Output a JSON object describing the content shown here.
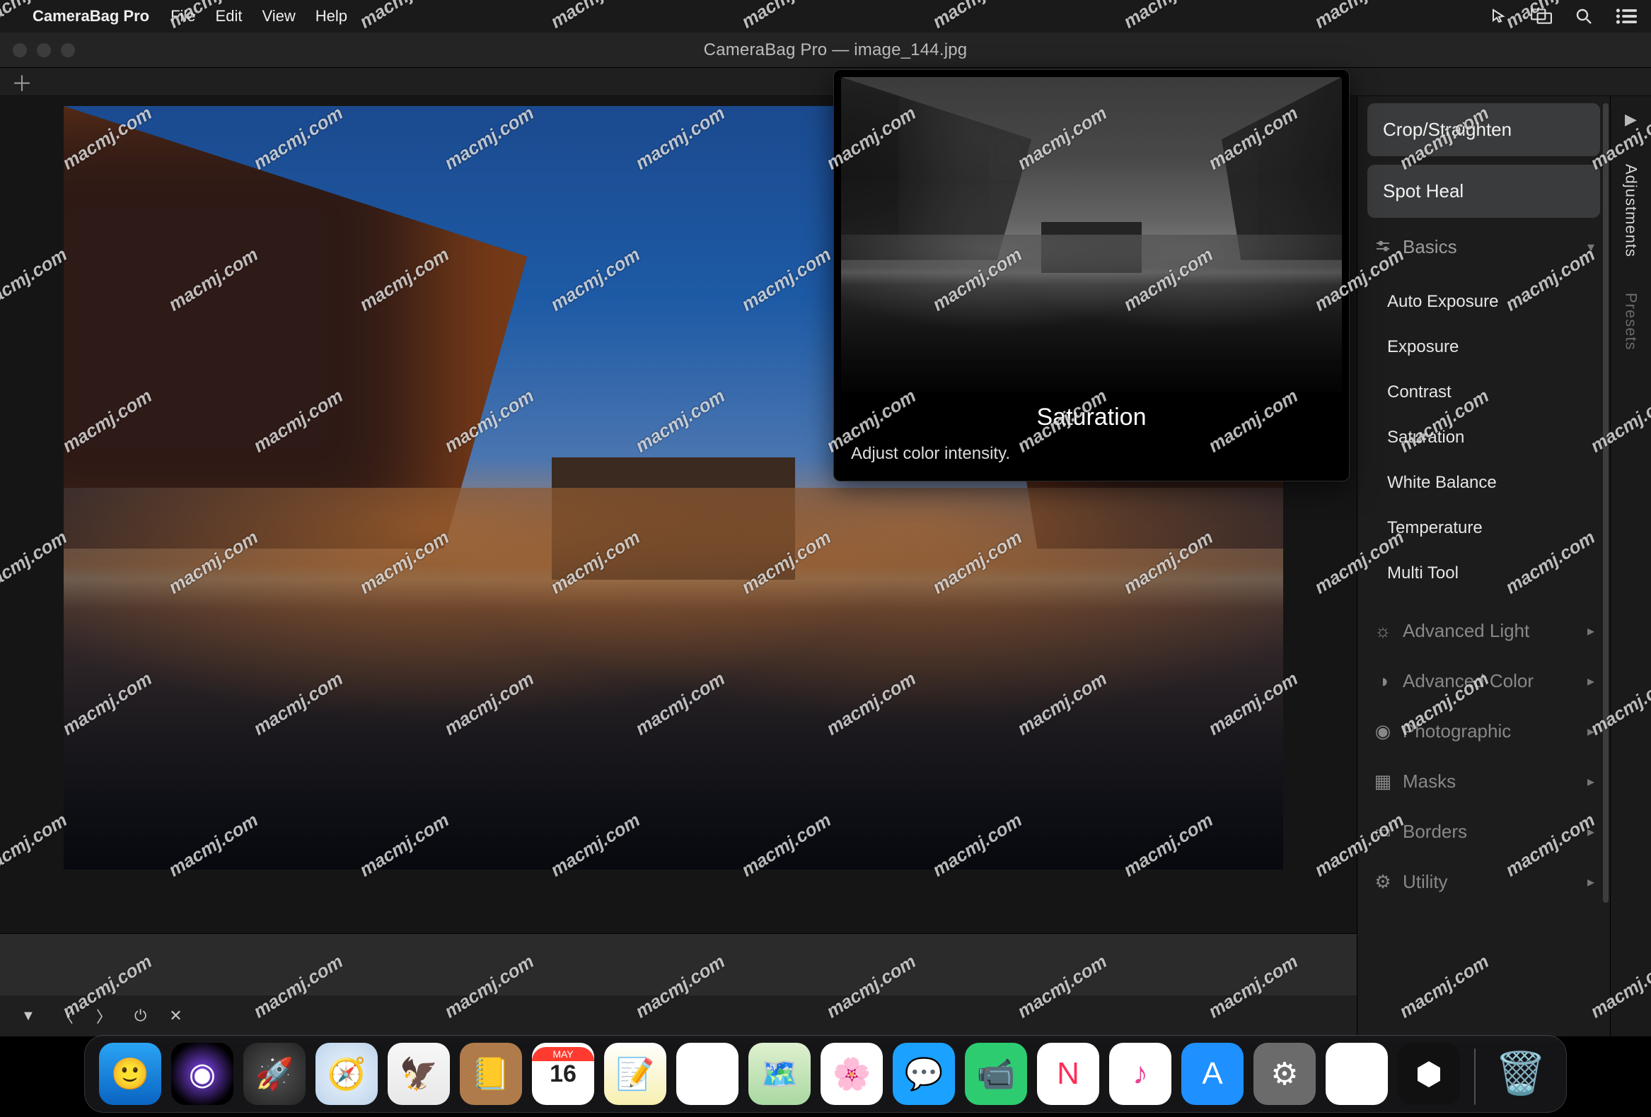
{
  "menubar": {
    "app": "CameraBag Pro",
    "items": [
      "File",
      "Edit",
      "View",
      "Help"
    ]
  },
  "window": {
    "title": "CameraBag Pro — image_144.jpg"
  },
  "rightRail": {
    "tabs": [
      "Adjustments",
      "Presets"
    ]
  },
  "panel": {
    "crop": "Crop/Straighten",
    "spot": "Spot Heal",
    "basics": {
      "label": "Basics",
      "items": [
        "Auto Exposure",
        "Exposure",
        "Contrast",
        "Saturation",
        "White Balance",
        "Temperature",
        "Multi Tool"
      ]
    },
    "sections": [
      {
        "label": "Advanced Light"
      },
      {
        "label": "Advanced Color"
      },
      {
        "label": "Photographic"
      },
      {
        "label": "Masks"
      },
      {
        "label": "Borders"
      },
      {
        "label": "Utility"
      }
    ]
  },
  "tooltip": {
    "title": "Saturation",
    "desc": "Adjust color intensity."
  },
  "dock": {
    "cal_month": "MAY",
    "cal_day": "16"
  },
  "watermark": "macmj.com"
}
